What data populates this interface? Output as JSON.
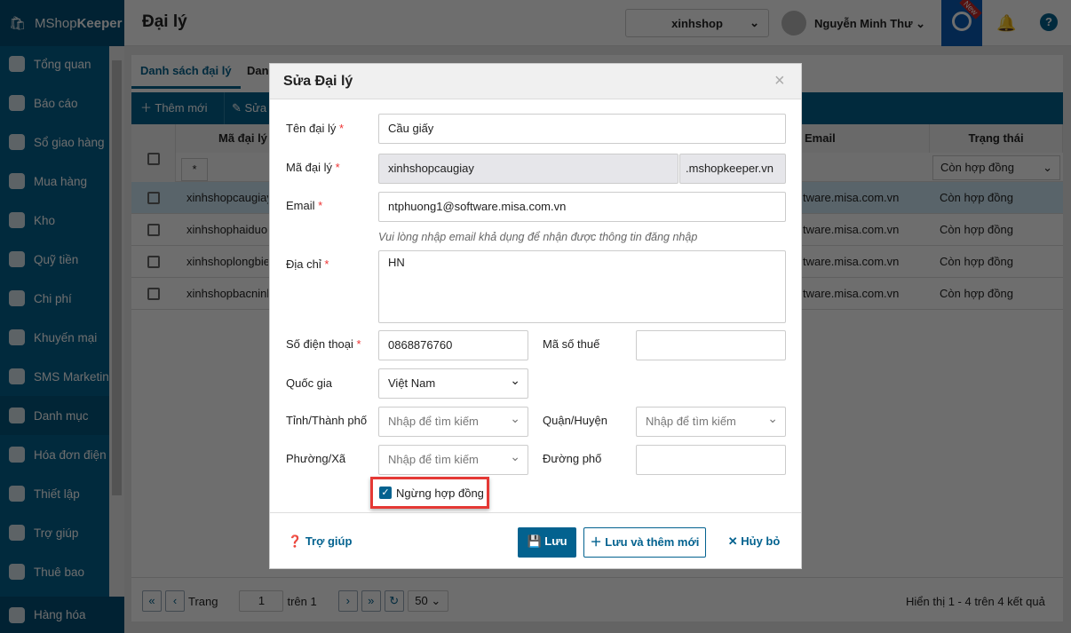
{
  "app": {
    "logo_light": "MShop",
    "logo_bold": "Keeper",
    "page_title": "Đại lý",
    "shop": "xinhshop",
    "user": "Nguyễn Minh Thư",
    "new_badge": "New"
  },
  "sidebar": {
    "items": [
      {
        "label": "Tổng quan"
      },
      {
        "label": "Báo cáo"
      },
      {
        "label": "Sổ giao hàng"
      },
      {
        "label": "Mua hàng"
      },
      {
        "label": "Kho"
      },
      {
        "label": "Quỹ tiền"
      },
      {
        "label": "Chi phí"
      },
      {
        "label": "Khuyến mại"
      },
      {
        "label": "SMS Marketing"
      },
      {
        "label": "Danh mục"
      },
      {
        "label": "Hóa đơn điện tử"
      },
      {
        "label": "Thiết lập"
      },
      {
        "label": "Trợ giúp"
      },
      {
        "label": "Thuê bao"
      },
      {
        "label": "Hàng hóa"
      }
    ]
  },
  "tabs": [
    "Danh sách đại lý",
    "Danh"
  ],
  "toolbar": {
    "add": "Thêm mới",
    "edit": "Sửa"
  },
  "table": {
    "headers": {
      "code": "Mã đại lý",
      "email": "Email",
      "status": "Trạng thái"
    },
    "status_filter": "Còn hợp đồng",
    "filter_symbol": "*",
    "rows": [
      {
        "code": "xinhshopcaugiay",
        "email": "tware.misa.com.vn",
        "status": "Còn hợp đồng"
      },
      {
        "code": "xinhshophaiduon",
        "email": "tware.misa.com.vn",
        "status": "Còn hợp đồng"
      },
      {
        "code": "xinhshoplongbie",
        "email": "tware.misa.com.vn",
        "status": "Còn hợp đồng"
      },
      {
        "code": "xinhshopbacninh",
        "email": "tware.misa.com.vn",
        "status": "Còn hợp đồng"
      }
    ]
  },
  "pager": {
    "page_label": "Trang",
    "page": "1",
    "of_label": "trên 1",
    "page_size": "50",
    "summary": "Hiển thị 1 - 4 trên 4 kết quả"
  },
  "modal": {
    "title": "Sửa Đại lý",
    "fields": {
      "name": {
        "label": "Tên đại lý",
        "value": "Cầu giấy"
      },
      "code": {
        "label": "Mã đại lý",
        "value": "xinhshopcaugiay",
        "suffix": ".mshopkeeper.vn"
      },
      "email": {
        "label": "Email",
        "value": "ntphuong1@software.misa.com.vn",
        "hint": "Vui lòng nhập email khả dụng để nhận được thông tin đăng nhập"
      },
      "address": {
        "label": "Địa chỉ",
        "value": "HN"
      },
      "phone": {
        "label": "Số điện thoại",
        "value": "0868876760"
      },
      "tax": {
        "label": "Mã số thuế",
        "value": ""
      },
      "country": {
        "label": "Quốc gia",
        "value": "Việt Nam"
      },
      "province": {
        "label": "Tỉnh/Thành phố",
        "placeholder": "Nhập để tìm kiếm"
      },
      "district": {
        "label": "Quận/Huyện",
        "placeholder": "Nhập để tìm kiếm"
      },
      "ward": {
        "label": "Phường/Xã",
        "placeholder": "Nhập để tìm kiếm"
      },
      "street": {
        "label": "Đường phố",
        "value": ""
      },
      "stop_contract": {
        "label": "Ngừng hợp đồng",
        "checked": true
      }
    },
    "required_mark": "*",
    "buttons": {
      "help": "Trợ giúp",
      "save": "Lưu",
      "save_new": "Lưu và thêm mới",
      "cancel": "Hủy bỏ"
    }
  },
  "colors": {
    "primary": "#03628f",
    "highlight": "#e53935"
  }
}
